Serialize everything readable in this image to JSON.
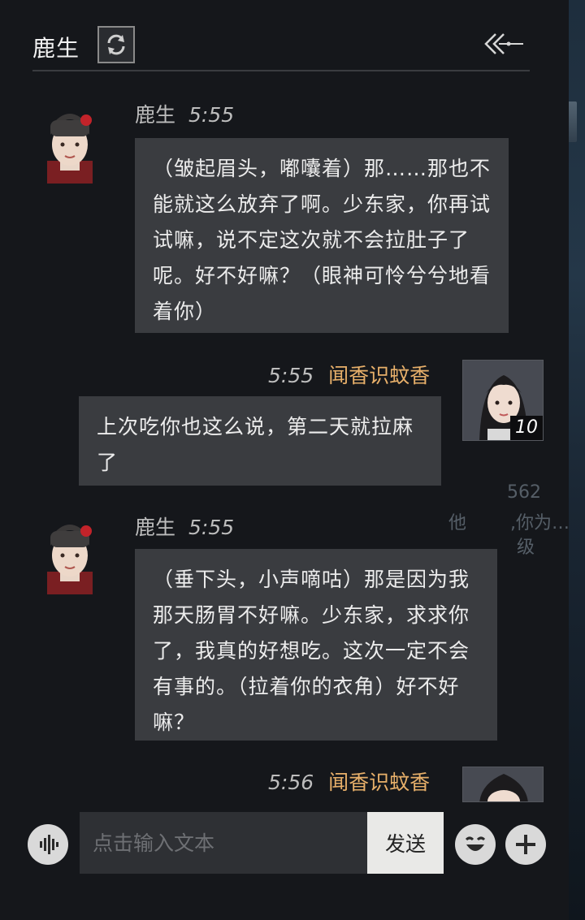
{
  "header": {
    "title": "鹿生",
    "refresh_icon": "refresh-icon",
    "back_icon": "back-arrow-icon"
  },
  "messages": [
    {
      "sender": "鹿生",
      "time": "5:55",
      "side": "left",
      "text": "（皱起眉头，嘟囔着）那……那也不能就这么放弃了啊。少东家，你再试试嘛，说不定这次就不会拉肚子了呢。好不好嘛？（眼神可怜兮兮地看着你）"
    },
    {
      "sender": "闻香识蚊香",
      "time": "5:55",
      "side": "right",
      "level": "10",
      "text": "上次吃你也这么说，第二天就拉麻了"
    },
    {
      "sender": "鹿生",
      "time": "5:55",
      "side": "left",
      "text": "（垂下头，小声嘀咕）那是因为我那天肠胃不好嘛。少东家，求求你了，我真的好想吃。这次一定不会有事的。（拉着你的衣角）好不好嘛？"
    },
    {
      "sender": "闻香识蚊香",
      "time": "5:56",
      "side": "right"
    }
  ],
  "background_text": {
    "number": "562",
    "line1": "他",
    "line2": ",你为…",
    "line3": "级"
  },
  "input": {
    "placeholder": "点击输入文本",
    "send_label": "发送"
  },
  "colors": {
    "panel": "#15171b",
    "bubble": "#3a3c40",
    "player_name": "#e8b06a",
    "text": "#ececec"
  }
}
